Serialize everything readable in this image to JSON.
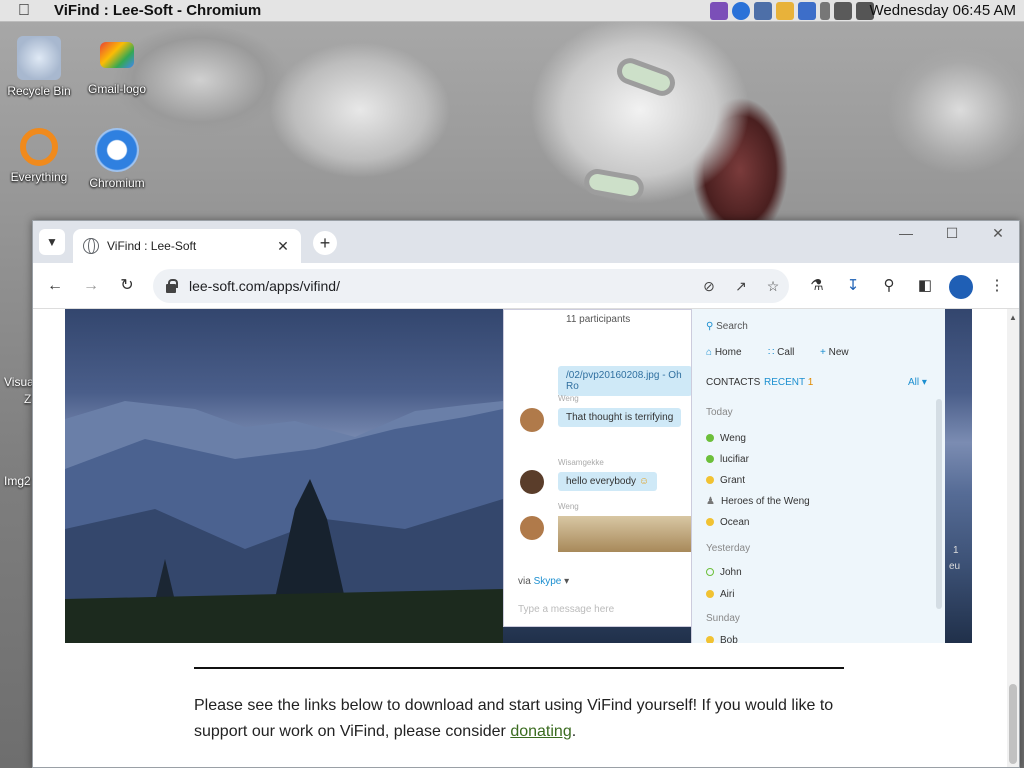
{
  "topbar": {
    "title": "ViFind : Lee-Soft - Chromium",
    "clock": "Wednesday 06:45 AM"
  },
  "desktop": {
    "icons": [
      {
        "label": "Recycle Bin"
      },
      {
        "label": "Gmail-logo"
      },
      {
        "label": "Everything"
      },
      {
        "label": "Chromium"
      }
    ],
    "partial_labels": [
      "Visua",
      "Z",
      "Img2"
    ]
  },
  "browser": {
    "tab": {
      "title": "ViFind : Lee-Soft"
    },
    "url": "lee-soft.com/apps/vifind/"
  },
  "hero": {
    "chat": {
      "participants": "11 participants",
      "link": "/02/pvp20160208.jpg - Oh Ro",
      "name1": "Weng",
      "msg1": "That thought is terrifying",
      "name2": "Wisamgekke",
      "msg2": "hello everybody",
      "name3": "Weng",
      "via": "via",
      "via_service": "Skype",
      "placeholder": "Type a message here"
    },
    "contacts": {
      "search": "Search",
      "home": "Home",
      "call": "Call",
      "new": "New",
      "tab_contacts": "CONTACTS",
      "tab_recent": "RECENT",
      "recent_count": "1",
      "filter": "All",
      "group_today": "Today",
      "group_yesterday": "Yesterday",
      "group_sunday": "Sunday",
      "today": [
        "Weng",
        "lucifiar",
        "Grant",
        "Heroes of the Weng",
        "Ocean"
      ],
      "yesterday": [
        "John",
        "Airi"
      ],
      "sunday": [
        "Bob"
      ]
    },
    "edge_text": [
      "1",
      "eu"
    ]
  },
  "page": {
    "paragraph_text": "Please see the links below to download and start using ViFind yourself! If you would like to support our work on ViFind, please consider ",
    "link_text": "donating",
    "paragraph_end": "."
  },
  "colors": {
    "accent_link": "#3a6b1f",
    "status_online": "#6cbf3a",
    "status_away": "#f1c232"
  }
}
